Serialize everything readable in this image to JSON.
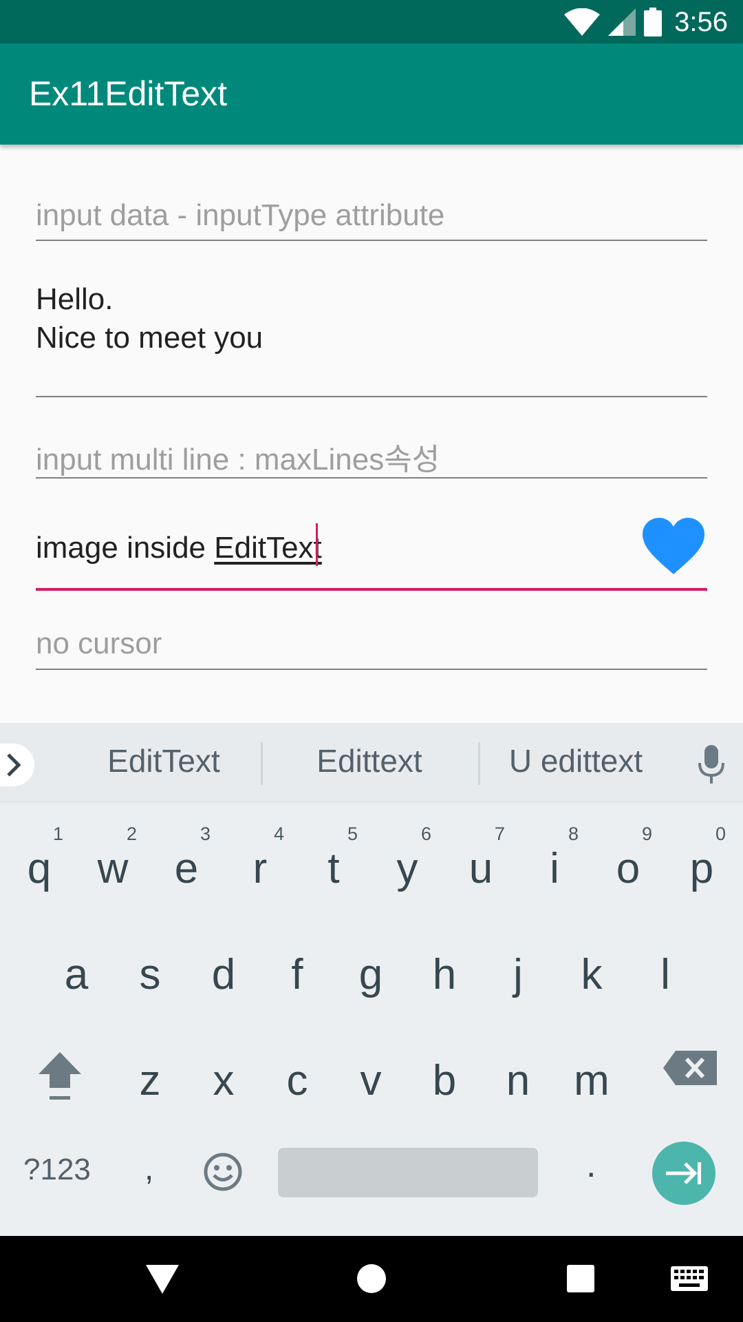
{
  "status_bar": {
    "time": "3:56"
  },
  "app_bar": {
    "title": "Ex11EditText"
  },
  "fields": {
    "input_type_hint": "input data - inputType attribute",
    "multiline_value": "Hello.\nNice to meet you",
    "max_lines_hint": "input multi line : maxLines속성",
    "image_field_prefix": "image inside ",
    "image_field_composing": "EditText",
    "no_cursor_hint": "no cursor"
  },
  "keyboard": {
    "suggestions": [
      "EditText",
      "Edittext",
      "U edittext"
    ],
    "row1": [
      {
        "ch": "q",
        "num": "1"
      },
      {
        "ch": "w",
        "num": "2"
      },
      {
        "ch": "e",
        "num": "3"
      },
      {
        "ch": "r",
        "num": "4"
      },
      {
        "ch": "t",
        "num": "5"
      },
      {
        "ch": "y",
        "num": "6"
      },
      {
        "ch": "u",
        "num": "7"
      },
      {
        "ch": "i",
        "num": "8"
      },
      {
        "ch": "o",
        "num": "9"
      },
      {
        "ch": "p",
        "num": "0"
      }
    ],
    "row2": [
      "a",
      "s",
      "d",
      "f",
      "g",
      "h",
      "j",
      "k",
      "l"
    ],
    "row3": [
      "z",
      "x",
      "c",
      "v",
      "b",
      "n",
      "m"
    ],
    "symbols_label": "?123",
    "comma": ",",
    "period": "."
  },
  "colors": {
    "status_bar": "#00695c",
    "app_bar": "#00897b",
    "accent": "#d81b60",
    "heart": "#1e90ff",
    "enter_key": "#4db6ac"
  }
}
